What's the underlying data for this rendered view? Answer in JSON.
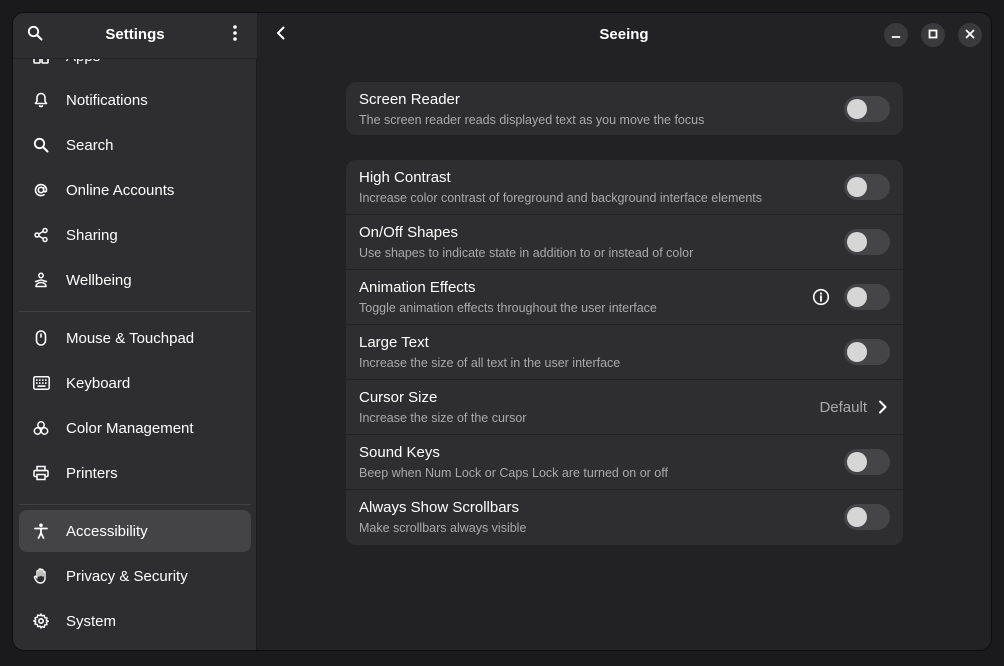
{
  "sidebar": {
    "title": "Settings",
    "items": [
      {
        "label": "Apps",
        "icon": "apps-icon"
      },
      {
        "label": "Notifications",
        "icon": "bell-icon"
      },
      {
        "label": "Search",
        "icon": "search-icon"
      },
      {
        "label": "Online Accounts",
        "icon": "at-icon"
      },
      {
        "label": "Sharing",
        "icon": "share-icon"
      },
      {
        "label": "Wellbeing",
        "icon": "wellbeing-icon"
      },
      {
        "label": "Mouse & Touchpad",
        "icon": "mouse-icon"
      },
      {
        "label": "Keyboard",
        "icon": "keyboard-icon"
      },
      {
        "label": "Color Management",
        "icon": "color-icon"
      },
      {
        "label": "Printers",
        "icon": "printer-icon"
      },
      {
        "label": "Accessibility",
        "icon": "accessibility-icon"
      },
      {
        "label": "Privacy & Security",
        "icon": "hand-icon"
      },
      {
        "label": "System",
        "icon": "gear-icon"
      }
    ],
    "selected": "Accessibility"
  },
  "main": {
    "title": "Seeing",
    "screen_reader": {
      "title": "Screen Reader",
      "subtitle": "The screen reader reads displayed text as you move the focus"
    },
    "rows": [
      {
        "title": "High Contrast",
        "subtitle": "Increase color contrast of foreground and background interface elements"
      },
      {
        "title": "On/Off Shapes",
        "subtitle": "Use shapes to indicate state in addition to or instead of color"
      },
      {
        "title": "Animation Effects",
        "subtitle": "Toggle animation effects throughout the user interface"
      },
      {
        "title": "Large Text",
        "subtitle": "Increase the size of all text in the user interface"
      },
      {
        "title": "Cursor Size",
        "subtitle": "Increase the size of the cursor",
        "value": "Default"
      },
      {
        "title": "Sound Keys",
        "subtitle": "Beep when Num Lock or Caps Lock are turned on or off"
      },
      {
        "title": "Always Show Scrollbars",
        "subtitle": "Make scrollbars always visible"
      }
    ]
  },
  "colors": {
    "accent_bg": "#222226",
    "sidebar_bg": "#2e2e32",
    "card_bg": "#2e2e32",
    "selected_bg": "#434348"
  }
}
